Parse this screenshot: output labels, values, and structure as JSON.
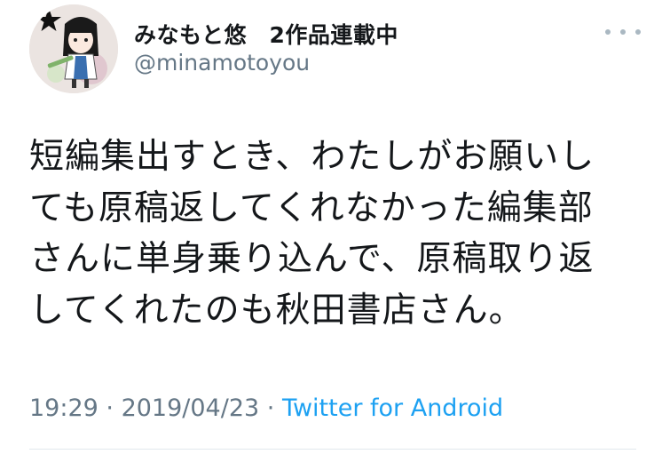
{
  "author": {
    "display_name": "みなもと悠　2作品連載中",
    "handle": "@minamotoyou"
  },
  "more_icon": "more-horizontal-icon",
  "tweet": {
    "lines": [
      "短編集出すとき、わたしがお願いし",
      "ても原稿返してくれなかった編集部",
      "さんに単身乗り込んで、原稿取り返",
      "してくれたのも秋田書店さん。"
    ]
  },
  "meta": {
    "time": "19:29",
    "separator1": " · ",
    "date": "2019/04/23",
    "separator2": " · ",
    "source": "Twitter for Android"
  },
  "colors": {
    "text": "#14171a",
    "secondary": "#657786",
    "link": "#1da1f2",
    "divider": "#e1e8ed"
  }
}
